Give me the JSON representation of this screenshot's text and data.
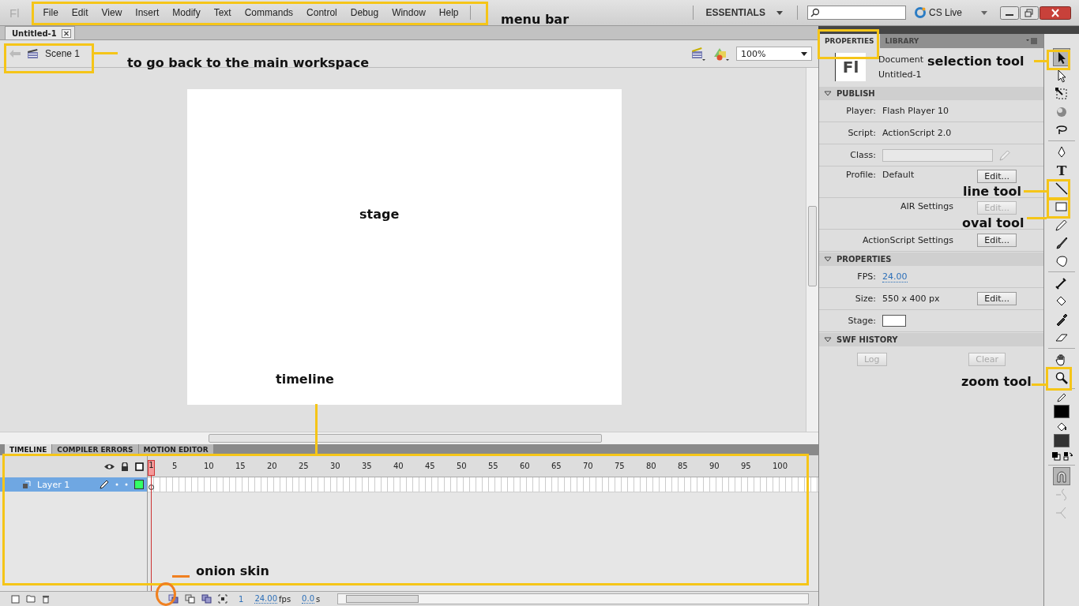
{
  "logo": "Fl",
  "menu": [
    "File",
    "Edit",
    "View",
    "Insert",
    "Modify",
    "Text",
    "Commands",
    "Control",
    "Debug",
    "Window",
    "Help"
  ],
  "workspace": "ESSENTIALS",
  "cs_live": "CS Live",
  "document_tab": "Untitled-1",
  "breadcrumb": "Scene 1",
  "zoom": "100%",
  "panel_tabs": [
    {
      "label": "PROPERTIES",
      "selected": true
    },
    {
      "label": "LIBRARY",
      "selected": false
    }
  ],
  "document": {
    "type": "Document",
    "name": "Untitled-1",
    "icon": "Fl"
  },
  "sections": [
    {
      "title": "PUBLISH",
      "expanded": true,
      "rows": [
        {
          "kind": "value",
          "label": "Player:",
          "value": "Flash Player 10"
        },
        {
          "kind": "value",
          "label": "Script:",
          "value": "ActionScript 2.0"
        },
        {
          "kind": "field",
          "label": "Class:"
        },
        {
          "kind": "value",
          "label": "Profile:",
          "value": "Default",
          "button": "Edit...",
          "disabled": false
        },
        {
          "kind": "setting",
          "label": "AIR Settings",
          "button": "Edit...",
          "disabled": true
        },
        {
          "kind": "setting",
          "label": "ActionScript Settings",
          "button": "Edit...",
          "disabled": false
        }
      ]
    },
    {
      "title": "PROPERTIES",
      "expanded": true,
      "rows": [
        {
          "kind": "link",
          "label": "FPS:",
          "value": "24.00"
        },
        {
          "kind": "value",
          "label": "Size:",
          "value": "550 x 400 px",
          "button": "Edit...",
          "disabled": false
        },
        {
          "kind": "swatch",
          "label": "Stage:",
          "color": "#ffffff"
        }
      ]
    },
    {
      "title": "SWF HISTORY",
      "expanded": true,
      "rows": [
        {
          "kind": "buttons",
          "buttons": [
            {
              "label": "Log",
              "disabled": true
            },
            {
              "label": "Clear",
              "disabled": true
            }
          ]
        }
      ]
    }
  ],
  "tools": [
    {
      "kind": "arrow",
      "selected": true
    },
    {
      "kind": "subselect",
      "selected": false
    },
    {
      "kind": "transform",
      "selected": false
    },
    {
      "kind": "rotate3d",
      "selected": false
    },
    {
      "kind": "lasso",
      "selected": false
    },
    {
      "kind": "sep"
    },
    {
      "kind": "pen",
      "selected": false
    },
    {
      "kind": "text",
      "glyph": "T",
      "selected": false
    },
    {
      "kind": "line",
      "selected": false
    },
    {
      "kind": "rect",
      "selected": false
    },
    {
      "kind": "pencil",
      "selected": false
    },
    {
      "kind": "brush",
      "selected": false
    },
    {
      "kind": "deco",
      "selected": false
    },
    {
      "kind": "sep"
    },
    {
      "kind": "bone",
      "selected": false
    },
    {
      "kind": "bucket",
      "selected": false
    },
    {
      "kind": "eyedropper",
      "selected": false
    },
    {
      "kind": "eraser",
      "selected": false
    },
    {
      "kind": "sep"
    },
    {
      "kind": "hand",
      "selected": false
    },
    {
      "kind": "zoom",
      "selected": false
    },
    {
      "kind": "sep"
    },
    {
      "kind": "stroke",
      "color": "#000000"
    },
    {
      "kind": "fill",
      "color": "#333333"
    },
    {
      "kind": "swap"
    },
    {
      "kind": "sep"
    },
    {
      "kind": "snap",
      "selected": true
    },
    {
      "kind": "smooth",
      "disabled": true
    },
    {
      "kind": "straighten",
      "disabled": true
    }
  ],
  "timeline": {
    "tabs": [
      {
        "label": "TIMELINE",
        "selected": true
      },
      {
        "label": "COMPILER ERRORS",
        "selected": false
      },
      {
        "label": "MOTION EDITOR",
        "selected": false
      }
    ],
    "playhead": "1",
    "frame_labels": [
      "5",
      "10",
      "15",
      "20",
      "25",
      "30",
      "35",
      "40",
      "45",
      "50",
      "55",
      "60",
      "65",
      "70",
      "75",
      "80",
      "85",
      "90",
      "95",
      "100"
    ],
    "layers": [
      {
        "name": "Layer 1",
        "selected": true,
        "color": "#33ff66"
      }
    ],
    "current_frame": "1",
    "fps": "24.00",
    "fps_unit": "fps",
    "time": "0.0",
    "time_unit": "s"
  },
  "annotations": [
    {
      "text": "menu bar"
    },
    {
      "text": "to go back to the main workspace"
    },
    {
      "text": "selection tool"
    },
    {
      "text": "stage"
    },
    {
      "text": "line tool"
    },
    {
      "text": "oval tool"
    },
    {
      "text": "timeline"
    },
    {
      "text": "zoom tool"
    },
    {
      "text": "onion skin"
    }
  ]
}
